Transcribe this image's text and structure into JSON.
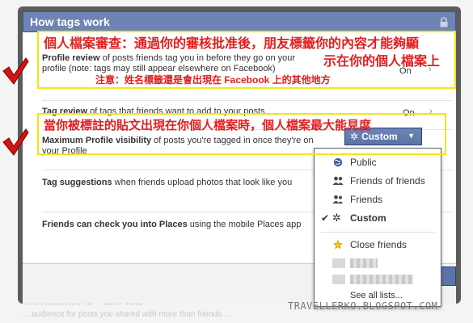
{
  "background_page": {
    "heading": "The Audience for Past Posts",
    "subtext": "... audience for posts you shared with more than friends ..."
  },
  "dialog": {
    "title": "How tags work",
    "rows": [
      {
        "title": "Profile review",
        "text": " of posts friends tag you in before they go on your profile (note: tags may still appear elsewhere on Facebook)",
        "status": "On"
      },
      {
        "title": "Tag review",
        "text": " of tags that friends want to add to your posts",
        "status": "On"
      },
      {
        "title": "Maximum Profile visibility",
        "text": " of posts you're tagged in once they're on your Profile",
        "status": "Custom"
      },
      {
        "title": "Tag suggestions",
        "text": " when friends upload photos that look like you"
      },
      {
        "title": "Friends can check you into Places",
        "text": " using the mobile Places app"
      }
    ],
    "done_label": "Done",
    "done_visible": "e"
  },
  "custom_menu": {
    "items": [
      {
        "label": "Public",
        "icon": "globe-icon",
        "checked": false
      },
      {
        "label": "Friends of friends",
        "icon": "friends-of-friends-icon",
        "checked": false
      },
      {
        "label": "Friends",
        "icon": "friends-icon",
        "checked": false
      },
      {
        "label": "Custom",
        "icon": "gear-icon",
        "checked": true
      }
    ],
    "close_friends": "Close friends",
    "see_all": "See all lists..."
  },
  "annotations": {
    "note1_line1": "個人檔案審查：通過你的審核批准後，朋友標籤你的內容才能夠顯",
    "note1_line2": "示在你的個人檔案上",
    "note1_small": "注意：姓名標籤還是會出現在 Facebook 上的其他地方",
    "note2": "當你被標註的貼文出現在你個人檔案時，個人檔案最大能見度"
  },
  "watermark": "TRAVELLERKO.BLOGSPOT.COM",
  "colors": {
    "facebook_blue": "#6d84b4",
    "annotation_red": "#e21e1e",
    "annotation_yellow": "#f2e612"
  }
}
